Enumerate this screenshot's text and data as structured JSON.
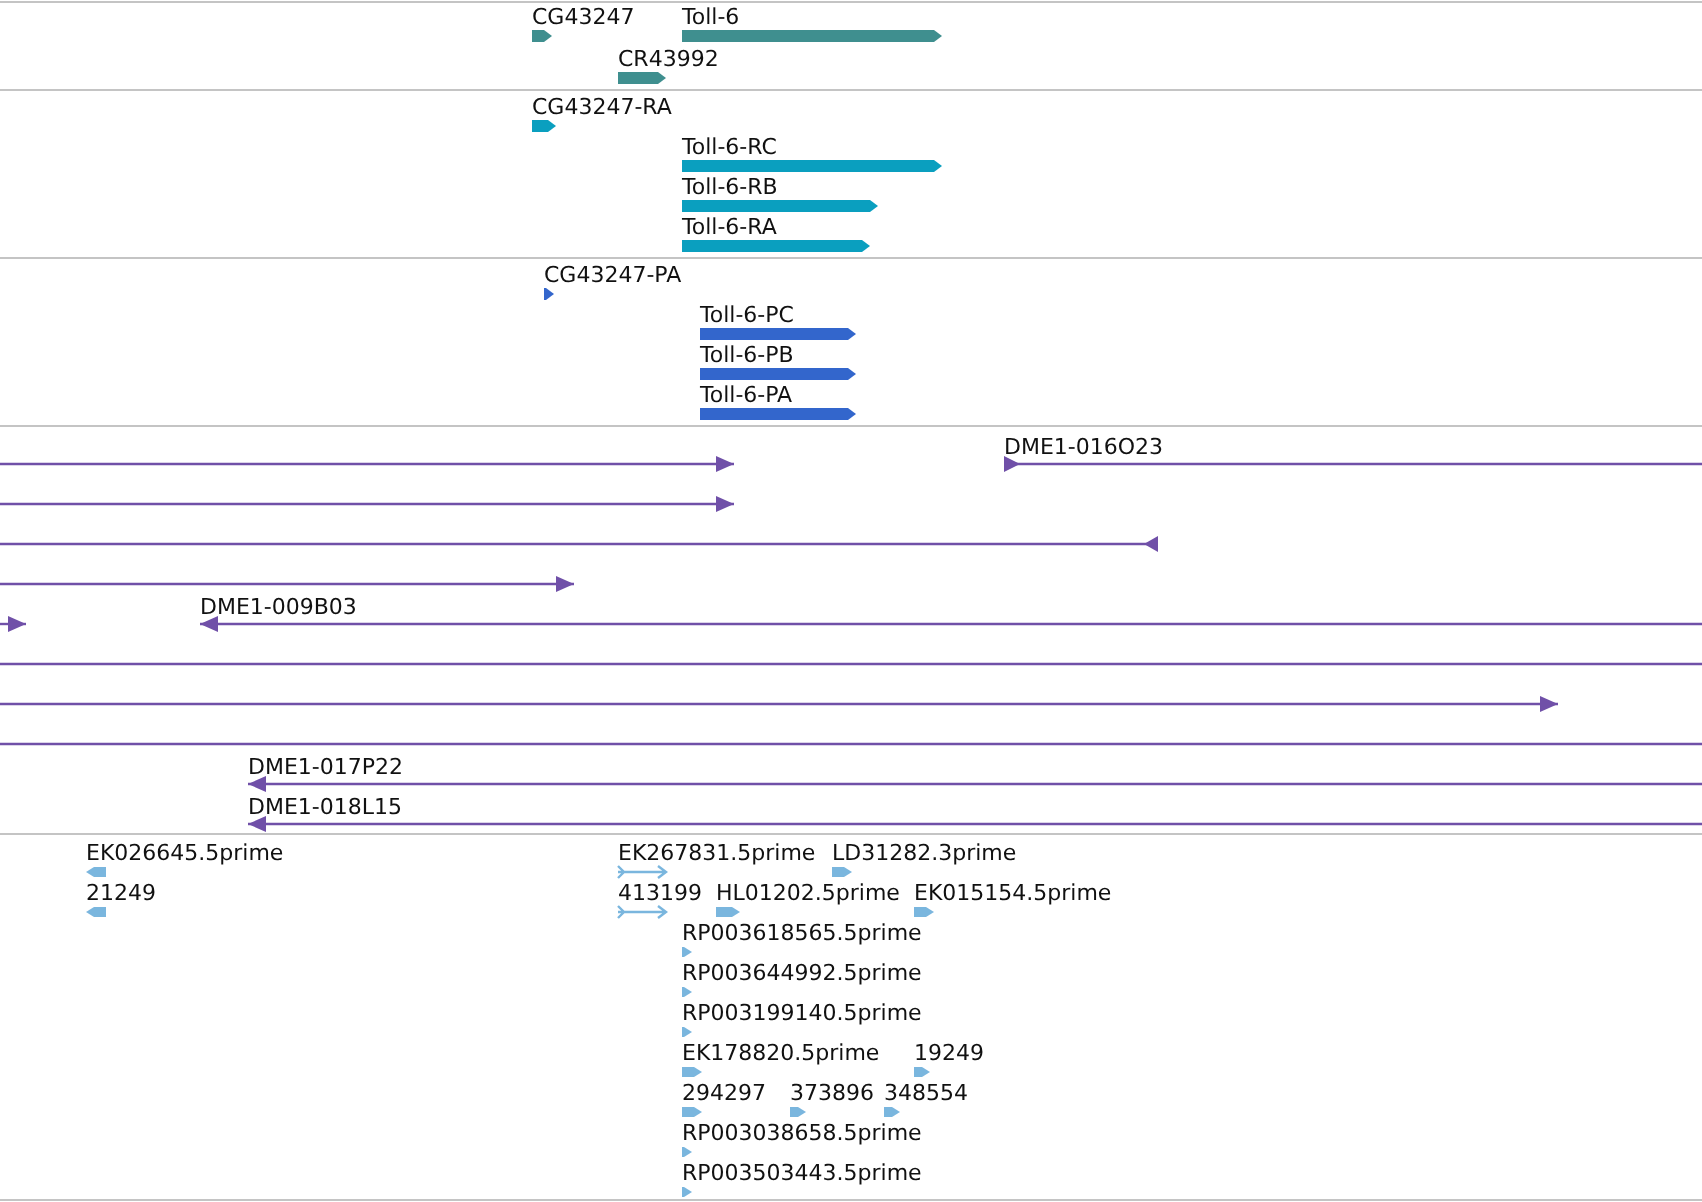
{
  "tracks": [
    {
      "kind": "gene",
      "color": "#3f8f8f",
      "features": [
        {
          "label": "CG43247",
          "kind": "forward"
        },
        {
          "label": "Toll-6",
          "kind": "forward"
        },
        {
          "label": "CR43992",
          "kind": "forward"
        }
      ]
    },
    {
      "kind": "gene",
      "color": "#0a9fbf",
      "features": [
        {
          "label": "CG43247-RA",
          "kind": "forward"
        },
        {
          "label": "Toll-6-RC",
          "kind": "forward"
        },
        {
          "label": "Toll-6-RB",
          "kind": "forward"
        },
        {
          "label": "Toll-6-RA",
          "kind": "forward"
        }
      ]
    },
    {
      "kind": "gene",
      "color": "#3366cc",
      "features": [
        {
          "label": "CG43247-PA",
          "kind": "forward"
        },
        {
          "label": "Toll-6-PC",
          "kind": "forward"
        },
        {
          "label": "Toll-6-PB",
          "kind": "forward"
        },
        {
          "label": "Toll-6-PA",
          "kind": "forward"
        }
      ]
    },
    {
      "kind": "clone",
      "color": "#7050a8",
      "features": [
        {
          "kind": "forward"
        },
        {
          "label": "DME1-016O23",
          "kind": "forward"
        },
        {
          "kind": "forward"
        },
        {
          "kind": "reverse"
        },
        {
          "kind": "forward"
        },
        {
          "kind": "forward"
        },
        {
          "label": "DME1-009B03",
          "kind": "reverse"
        },
        {
          "kind": "plain"
        },
        {
          "kind": "forward"
        },
        {
          "kind": "plain"
        },
        {
          "label": "DME1-017P22",
          "kind": "reverse"
        },
        {
          "label": "DME1-018L15",
          "kind": "reverse"
        }
      ]
    },
    {
      "kind": "est",
      "color": "#7ab6de",
      "features": [
        {
          "label": "EK026645.5prime",
          "kind": "reverse"
        },
        {
          "label": "21249",
          "kind": "reverse"
        },
        {
          "label": "EK267831.5prime",
          "kind": "paired"
        },
        {
          "label": "LD31282.3prime",
          "kind": "forward"
        },
        {
          "label": "413199",
          "kind": "paired"
        },
        {
          "label": "HL01202.5prime",
          "kind": "forward"
        },
        {
          "label": "EK015154.5prime",
          "kind": "forward"
        },
        {
          "label": "RP003618565.5prime",
          "kind": "forward"
        },
        {
          "label": "RP003644992.5prime",
          "kind": "forward"
        },
        {
          "label": "RP003199140.5prime",
          "kind": "forward"
        },
        {
          "label": "EK178820.5prime",
          "kind": "forward"
        },
        {
          "label": "19249",
          "kind": "forward"
        },
        {
          "label": "294297",
          "kind": "forward"
        },
        {
          "label": "373896",
          "kind": "forward"
        },
        {
          "label": "348554",
          "kind": "forward"
        },
        {
          "label": "RP003038658.5prime",
          "kind": "forward"
        },
        {
          "label": "RP003503443.5prime",
          "kind": "forward"
        }
      ]
    }
  ]
}
